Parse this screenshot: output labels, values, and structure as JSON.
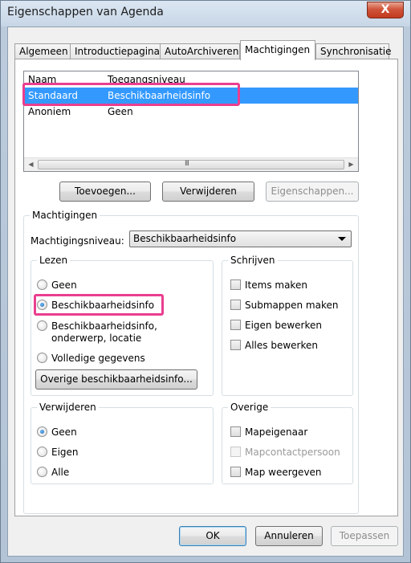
{
  "window": {
    "title": "Eigenschappen van Agenda",
    "close_label": "X"
  },
  "tabs": [
    {
      "label": "Algemeen"
    },
    {
      "label": "Introductiepagina"
    },
    {
      "label": "AutoArchiveren"
    },
    {
      "label": "Machtigingen",
      "active": true
    },
    {
      "label": "Synchronisatie"
    }
  ],
  "permissions_list": {
    "headers": [
      "Naam",
      "Toegangsniveau"
    ],
    "rows": [
      {
        "name": "Standaard",
        "level": "Beschikbaarheidsinfo",
        "selected": true
      },
      {
        "name": "Anoniem",
        "level": "Geen"
      }
    ],
    "scroll": {
      "left": "◀",
      "right": "▶",
      "grip": "III"
    }
  },
  "list_buttons": {
    "add": "Toevoegen...",
    "remove": "Verwijderen",
    "properties": "Eigenschappen..."
  },
  "permissions": {
    "group_label": "Machtigingen",
    "level_label": "Machtigingsniveau:",
    "level_value": "Beschikbaarheidsinfo",
    "read": {
      "label": "Lezen",
      "options": [
        "Geen",
        "Beschikbaarheidsinfo",
        "Beschikbaarheidsinfo,",
        "Volledige gegevens"
      ],
      "option3_line2": "onderwerp, locatie",
      "selected": "Beschikbaarheidsinfo",
      "other_button": "Overige beschikbaarheidsinfo..."
    },
    "write": {
      "label": "Schrijven",
      "options": [
        "Items maken",
        "Submappen maken",
        "Eigen bewerken",
        "Alles bewerken"
      ]
    },
    "delete": {
      "label": "Verwijderen",
      "options": [
        "Geen",
        "Eigen",
        "Alle"
      ],
      "selected": "Geen"
    },
    "other": {
      "label": "Overige",
      "options": [
        "Mapeigenaar",
        "Mapcontactpersoon",
        "Map weergeven"
      ]
    }
  },
  "dialog_buttons": {
    "ok": "OK",
    "cancel": "Annuleren",
    "apply": "Toepassen"
  },
  "colors": {
    "selection": "#3399ff",
    "highlight": "#ea3e8f",
    "close": "#c23a1e"
  }
}
